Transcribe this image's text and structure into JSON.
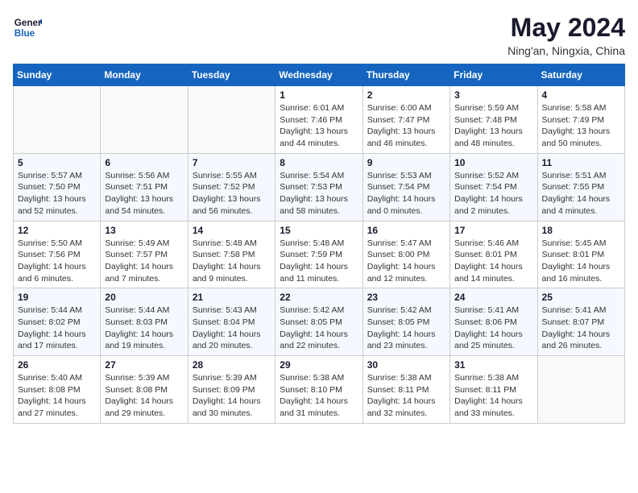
{
  "header": {
    "logo_line1": "General",
    "logo_line2": "Blue",
    "month_year": "May 2024",
    "location": "Ning'an, Ningxia, China"
  },
  "weekdays": [
    "Sunday",
    "Monday",
    "Tuesday",
    "Wednesday",
    "Thursday",
    "Friday",
    "Saturday"
  ],
  "weeks": [
    [
      {
        "day": "",
        "info": ""
      },
      {
        "day": "",
        "info": ""
      },
      {
        "day": "",
        "info": ""
      },
      {
        "day": "1",
        "info": "Sunrise: 6:01 AM\nSunset: 7:46 PM\nDaylight: 13 hours\nand 44 minutes."
      },
      {
        "day": "2",
        "info": "Sunrise: 6:00 AM\nSunset: 7:47 PM\nDaylight: 13 hours\nand 46 minutes."
      },
      {
        "day": "3",
        "info": "Sunrise: 5:59 AM\nSunset: 7:48 PM\nDaylight: 13 hours\nand 48 minutes."
      },
      {
        "day": "4",
        "info": "Sunrise: 5:58 AM\nSunset: 7:49 PM\nDaylight: 13 hours\nand 50 minutes."
      }
    ],
    [
      {
        "day": "5",
        "info": "Sunrise: 5:57 AM\nSunset: 7:50 PM\nDaylight: 13 hours\nand 52 minutes."
      },
      {
        "day": "6",
        "info": "Sunrise: 5:56 AM\nSunset: 7:51 PM\nDaylight: 13 hours\nand 54 minutes."
      },
      {
        "day": "7",
        "info": "Sunrise: 5:55 AM\nSunset: 7:52 PM\nDaylight: 13 hours\nand 56 minutes."
      },
      {
        "day": "8",
        "info": "Sunrise: 5:54 AM\nSunset: 7:53 PM\nDaylight: 13 hours\nand 58 minutes."
      },
      {
        "day": "9",
        "info": "Sunrise: 5:53 AM\nSunset: 7:54 PM\nDaylight: 14 hours\nand 0 minutes."
      },
      {
        "day": "10",
        "info": "Sunrise: 5:52 AM\nSunset: 7:54 PM\nDaylight: 14 hours\nand 2 minutes."
      },
      {
        "day": "11",
        "info": "Sunrise: 5:51 AM\nSunset: 7:55 PM\nDaylight: 14 hours\nand 4 minutes."
      }
    ],
    [
      {
        "day": "12",
        "info": "Sunrise: 5:50 AM\nSunset: 7:56 PM\nDaylight: 14 hours\nand 6 minutes."
      },
      {
        "day": "13",
        "info": "Sunrise: 5:49 AM\nSunset: 7:57 PM\nDaylight: 14 hours\nand 7 minutes."
      },
      {
        "day": "14",
        "info": "Sunrise: 5:48 AM\nSunset: 7:58 PM\nDaylight: 14 hours\nand 9 minutes."
      },
      {
        "day": "15",
        "info": "Sunrise: 5:48 AM\nSunset: 7:59 PM\nDaylight: 14 hours\nand 11 minutes."
      },
      {
        "day": "16",
        "info": "Sunrise: 5:47 AM\nSunset: 8:00 PM\nDaylight: 14 hours\nand 12 minutes."
      },
      {
        "day": "17",
        "info": "Sunrise: 5:46 AM\nSunset: 8:01 PM\nDaylight: 14 hours\nand 14 minutes."
      },
      {
        "day": "18",
        "info": "Sunrise: 5:45 AM\nSunset: 8:01 PM\nDaylight: 14 hours\nand 16 minutes."
      }
    ],
    [
      {
        "day": "19",
        "info": "Sunrise: 5:44 AM\nSunset: 8:02 PM\nDaylight: 14 hours\nand 17 minutes."
      },
      {
        "day": "20",
        "info": "Sunrise: 5:44 AM\nSunset: 8:03 PM\nDaylight: 14 hours\nand 19 minutes."
      },
      {
        "day": "21",
        "info": "Sunrise: 5:43 AM\nSunset: 8:04 PM\nDaylight: 14 hours\nand 20 minutes."
      },
      {
        "day": "22",
        "info": "Sunrise: 5:42 AM\nSunset: 8:05 PM\nDaylight: 14 hours\nand 22 minutes."
      },
      {
        "day": "23",
        "info": "Sunrise: 5:42 AM\nSunset: 8:05 PM\nDaylight: 14 hours\nand 23 minutes."
      },
      {
        "day": "24",
        "info": "Sunrise: 5:41 AM\nSunset: 8:06 PM\nDaylight: 14 hours\nand 25 minutes."
      },
      {
        "day": "25",
        "info": "Sunrise: 5:41 AM\nSunset: 8:07 PM\nDaylight: 14 hours\nand 26 minutes."
      }
    ],
    [
      {
        "day": "26",
        "info": "Sunrise: 5:40 AM\nSunset: 8:08 PM\nDaylight: 14 hours\nand 27 minutes."
      },
      {
        "day": "27",
        "info": "Sunrise: 5:39 AM\nSunset: 8:08 PM\nDaylight: 14 hours\nand 29 minutes."
      },
      {
        "day": "28",
        "info": "Sunrise: 5:39 AM\nSunset: 8:09 PM\nDaylight: 14 hours\nand 30 minutes."
      },
      {
        "day": "29",
        "info": "Sunrise: 5:38 AM\nSunset: 8:10 PM\nDaylight: 14 hours\nand 31 minutes."
      },
      {
        "day": "30",
        "info": "Sunrise: 5:38 AM\nSunset: 8:11 PM\nDaylight: 14 hours\nand 32 minutes."
      },
      {
        "day": "31",
        "info": "Sunrise: 5:38 AM\nSunset: 8:11 PM\nDaylight: 14 hours\nand 33 minutes."
      },
      {
        "day": "",
        "info": ""
      }
    ]
  ]
}
